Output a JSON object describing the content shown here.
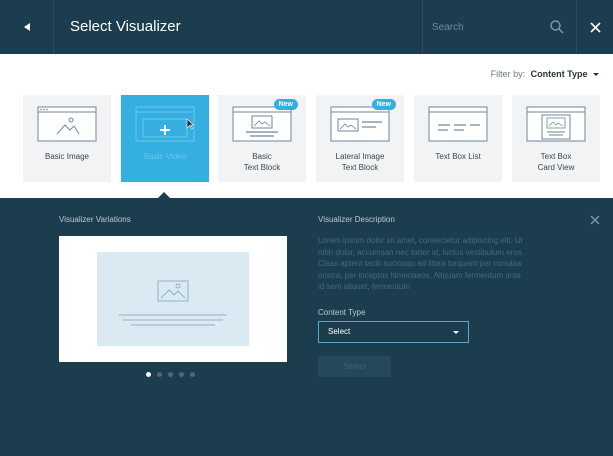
{
  "header": {
    "title": "Select Visualizer",
    "search_placeholder": "Search"
  },
  "filter": {
    "label": "Filter by:",
    "value": "Content Type"
  },
  "visualizers": [
    {
      "label": "Basic Image",
      "badge": "",
      "selected": false
    },
    {
      "label": "Basic Video",
      "badge": "",
      "selected": true
    },
    {
      "label": "Basic\nText Block",
      "badge": "New",
      "selected": false
    },
    {
      "label": "Lateral Image\nText Block",
      "badge": "New",
      "selected": false
    },
    {
      "label": "Text Box List",
      "badge": "",
      "selected": false
    },
    {
      "label": "Text Box\nCard View",
      "badge": "",
      "selected": false
    }
  ],
  "details": {
    "variations_heading": "Visualizer Variations",
    "description_heading": "Visualizer Description",
    "description_text": "Lorem ipsum dolor sit amet, consectetur adipiscing elit. Ut nibh dolor, accumsan nec tortor id, luctus vestibulum eros. Class aptent taciti sociosqu ad litora torquent per conubia nostra, per inceptos himenaeos. Aliquam fermentum ante id sem aliquet, fermentum",
    "content_type_label": "Content Type",
    "select_placeholder": "Select",
    "select_button": "Select",
    "carousel": {
      "count": 5,
      "active": 0
    }
  },
  "colors": {
    "header_bg": "#1c3d4e",
    "accent": "#35aee0",
    "panel_bg": "#1c3d4e"
  }
}
